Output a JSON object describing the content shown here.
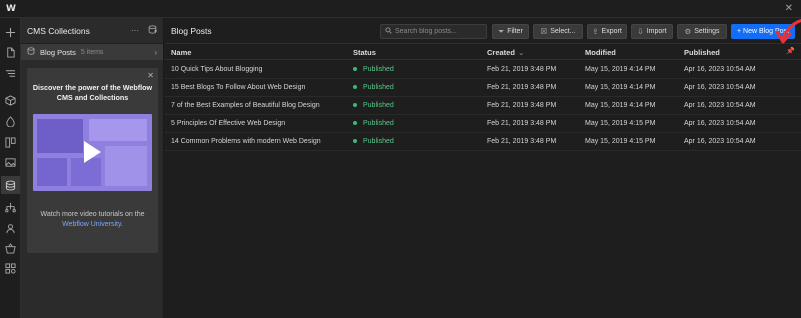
{
  "topbar": {
    "logo": "W",
    "close": "✕"
  },
  "rail": {
    "icons": [
      "add-icon",
      "page-icon",
      "navigator-icon",
      "components-icon",
      "style-icon",
      "assets-icon",
      "image-icon",
      "cms-icon",
      "logic-icon",
      "users-icon",
      "ecommerce-icon",
      "apps-icon"
    ]
  },
  "panel": {
    "title": "CMS Collections",
    "more": "···",
    "settings_icon": "collection-settings-icon",
    "collection": {
      "name": "Blog Posts",
      "count": "5 items"
    },
    "promo": {
      "title": "Discover the power of the Webflow CMS and Collections",
      "text": "Watch more video tutorials on the",
      "link": "Webflow University",
      "link_suffix": "."
    }
  },
  "main": {
    "title": "Blog Posts",
    "search": {
      "placeholder": "Search blog posts..."
    },
    "buttons": {
      "filter": "Filter",
      "select": "Select...",
      "export": "Export",
      "import": "Import",
      "settings": "Settings",
      "new_post": "+ New Blog Post"
    },
    "columns": {
      "name": "Name",
      "status": "Status",
      "created": "Created",
      "modified": "Modified",
      "published": "Published"
    },
    "rows": [
      {
        "name": "10 Quick Tips About Blogging",
        "status": "Published",
        "created": "Feb 21, 2019 3:48 PM",
        "modified": "May 15, 2019 4:14 PM",
        "published": "Apr 16, 2023 10:54 AM"
      },
      {
        "name": "15 Best Blogs To Follow About Web Design",
        "status": "Published",
        "created": "Feb 21, 2019 3:48 PM",
        "modified": "May 15, 2019 4:14 PM",
        "published": "Apr 16, 2023 10:54 AM"
      },
      {
        "name": "7 of the Best Examples of Beautiful Blog Design",
        "status": "Published",
        "created": "Feb 21, 2019 3:48 PM",
        "modified": "May 15, 2019 4:14 PM",
        "published": "Apr 16, 2023 10:54 AM"
      },
      {
        "name": "5 Principles Of Effective Web Design",
        "status": "Published",
        "created": "Feb 21, 2019 3:48 PM",
        "modified": "May 15, 2019 4:15 PM",
        "published": "Apr 16, 2023 10:54 AM"
      },
      {
        "name": "14 Common Problems with modern Web Design",
        "status": "Published",
        "created": "Feb 21, 2019 3:48 PM",
        "modified": "May 15, 2019 4:15 PM",
        "published": "Apr 16, 2023 10:54 AM"
      }
    ]
  },
  "colors": {
    "accent": "#146ef5",
    "published": "#56c98a",
    "annotation": "#e8323a"
  }
}
